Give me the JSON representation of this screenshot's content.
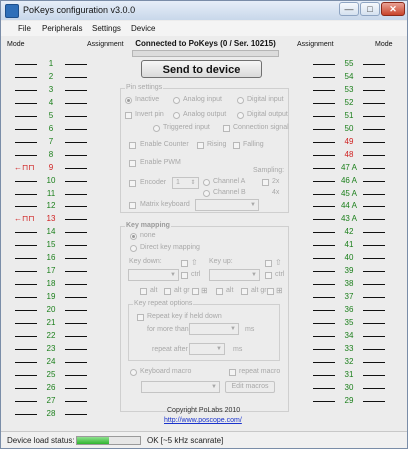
{
  "window": {
    "title": "PoKeys configuration v3.0.0",
    "controls": {
      "minimize": "—",
      "maximize": "□",
      "close": "✕"
    }
  },
  "menu": [
    "File",
    "Peripherals",
    "Settings",
    "Device"
  ],
  "headers": {
    "mode_left": "Mode",
    "assignment_left": "Assignment",
    "assignment_right": "Assignment",
    "mode_right": "Mode"
  },
  "connection": "Connected to PoKeys (0 / Ser. 10215)",
  "send_button": "Send to device",
  "pins_left": [
    {
      "label": "1",
      "red": false,
      "indicator": ""
    },
    {
      "label": "2",
      "red": false,
      "indicator": ""
    },
    {
      "label": "3",
      "red": false,
      "indicator": ""
    },
    {
      "label": "4",
      "red": false,
      "indicator": ""
    },
    {
      "label": "5",
      "red": false,
      "indicator": ""
    },
    {
      "label": "6",
      "red": false,
      "indicator": ""
    },
    {
      "label": "7",
      "red": false,
      "indicator": ""
    },
    {
      "label": "8",
      "red": false,
      "indicator": ""
    },
    {
      "label": "9",
      "red": true,
      "indicator": "←⊓⊓"
    },
    {
      "label": "10",
      "red": false,
      "indicator": ""
    },
    {
      "label": "11",
      "red": false,
      "indicator": ""
    },
    {
      "label": "12",
      "red": false,
      "indicator": ""
    },
    {
      "label": "13",
      "red": true,
      "indicator": "←⊓⊓"
    },
    {
      "label": "14",
      "red": false,
      "indicator": ""
    },
    {
      "label": "15",
      "red": false,
      "indicator": ""
    },
    {
      "label": "16",
      "red": false,
      "indicator": ""
    },
    {
      "label": "17",
      "red": false,
      "indicator": ""
    },
    {
      "label": "18",
      "red": false,
      "indicator": ""
    },
    {
      "label": "19",
      "red": false,
      "indicator": ""
    },
    {
      "label": "20",
      "red": false,
      "indicator": ""
    },
    {
      "label": "21",
      "red": false,
      "indicator": ""
    },
    {
      "label": "22",
      "red": false,
      "indicator": ""
    },
    {
      "label": "23",
      "red": false,
      "indicator": ""
    },
    {
      "label": "24",
      "red": false,
      "indicator": ""
    },
    {
      "label": "25",
      "red": false,
      "indicator": ""
    },
    {
      "label": "26",
      "red": false,
      "indicator": ""
    },
    {
      "label": "27",
      "red": false,
      "indicator": ""
    },
    {
      "label": "28",
      "red": false,
      "indicator": ""
    }
  ],
  "pins_right": [
    {
      "label": "55",
      "red": false
    },
    {
      "label": "54",
      "red": false
    },
    {
      "label": "53",
      "red": false
    },
    {
      "label": "52",
      "red": false
    },
    {
      "label": "51",
      "red": false
    },
    {
      "label": "50",
      "red": false
    },
    {
      "label": "49",
      "red": true
    },
    {
      "label": "48",
      "red": true
    },
    {
      "label": "47 A",
      "red": false
    },
    {
      "label": "46 A",
      "red": false
    },
    {
      "label": "45 A",
      "red": false
    },
    {
      "label": "44 A",
      "red": false
    },
    {
      "label": "43 A",
      "red": false
    },
    {
      "label": "42",
      "red": false
    },
    {
      "label": "41",
      "red": false
    },
    {
      "label": "40",
      "red": false
    },
    {
      "label": "39",
      "red": false
    },
    {
      "label": "38",
      "red": false
    },
    {
      "label": "37",
      "red": false
    },
    {
      "label": "36",
      "red": false
    },
    {
      "label": "35",
      "red": false
    },
    {
      "label": "34",
      "red": false
    },
    {
      "label": "33",
      "red": false
    },
    {
      "label": "32",
      "red": false
    },
    {
      "label": "31",
      "red": false
    },
    {
      "label": "30",
      "red": false
    },
    {
      "label": "29",
      "red": false
    }
  ],
  "pin_settings": {
    "title": "Pin settings",
    "inactive": "Inactive",
    "analog_input": "Analog input",
    "digital_input": "Digital input",
    "invert_pin": "Invert pin",
    "analog_output": "Analog output",
    "digital_output": "Digital output",
    "triggered_input": "Triggered input",
    "connection_signal": "Connection signal",
    "enable_counter": "Enable Counter",
    "rising": "Rising",
    "falling": "Falling",
    "enable_pwm": "Enable PWM",
    "sampling": "Sampling:",
    "encoder": "Encoder",
    "encoder_value": "1",
    "channel_a": "Channel A",
    "channel_b": "Channel B",
    "x2": "2x",
    "x4": "4x",
    "matrix_keyboard": "Matrix keyboard"
  },
  "key_mapping": {
    "title": "Key mapping",
    "none": "none",
    "direct": "Direct key mapping",
    "key_down": "Key down:",
    "key_up": "Key up:",
    "ctrl": "ctrl",
    "alt": "alt",
    "alt_gr": "alt gr",
    "repeat_title": "Key repeat options",
    "repeat_key": "Repeat key if held down",
    "for_more_than": "for more than",
    "repeat_after": "repeat after",
    "ms": "ms",
    "keyboard_macro": "Keyboard macro",
    "repeat_macro": "repeat macro",
    "edit_macros": "Edit macros"
  },
  "footer": {
    "copyright": "Copyright PoLabs 2010",
    "url": "http://www.poscope.com/"
  },
  "status": {
    "label": "Device load status:",
    "progress": 0.5,
    "text": "OK [~5 kHz scanrate]"
  }
}
